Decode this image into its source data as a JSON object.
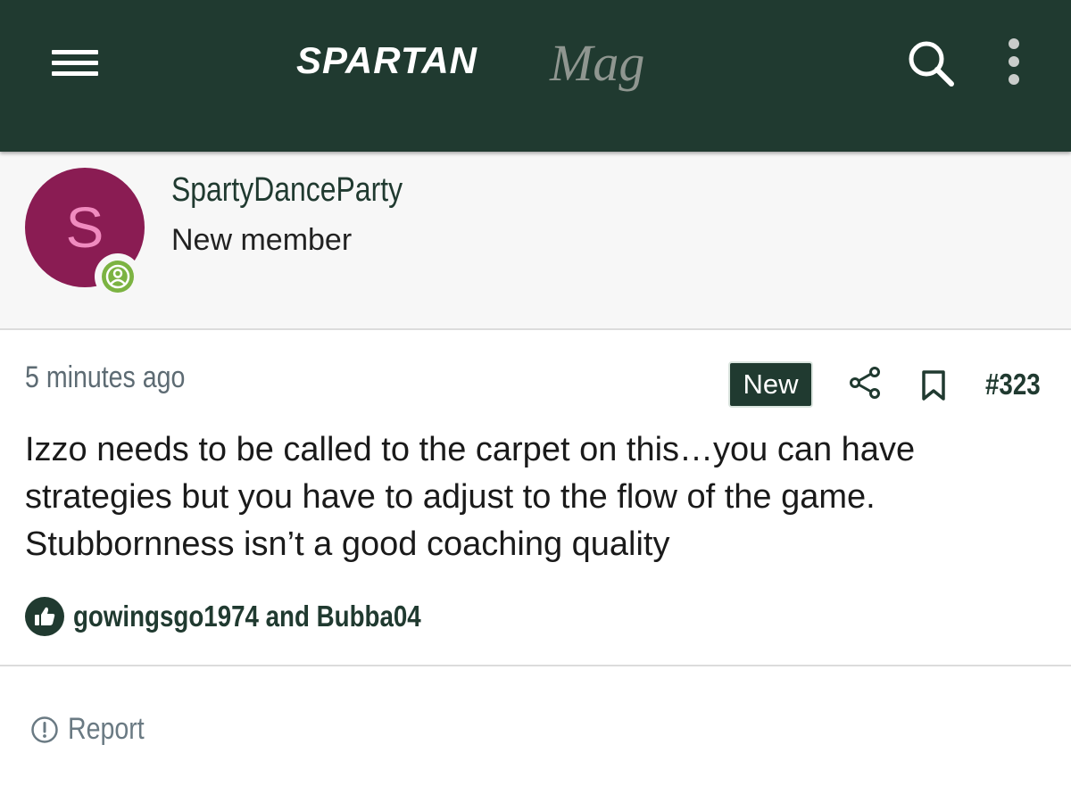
{
  "header": {
    "logo_text_bold": "SPARTAN",
    "logo_text_script": "Mag",
    "menu_icon": "hamburger-menu-icon",
    "search_icon": "search-icon",
    "more_icon": "vertical-dots-icon"
  },
  "member": {
    "avatar_letter": "S",
    "username": "SpartyDanceParty",
    "title": "New member",
    "status_icon": "online-user-icon"
  },
  "post": {
    "timestamp": "5 minutes ago",
    "new_badge": "New",
    "number": "#323",
    "body": "Izzo needs to be called to the carpet on this…you can have strategies but you have to adjust to the flow of the game. Stubbornness isn’t a good coaching quality",
    "reactions": "gowingsgo1974 and Bubba04"
  },
  "actions": {
    "report_label": "Report"
  },
  "colors": {
    "brand_green": "#203a30",
    "avatar_bg": "#8a1c53",
    "avatar_letter": "#f08bbf",
    "online_green": "#7cb342",
    "muted_text": "#5d6b73"
  }
}
